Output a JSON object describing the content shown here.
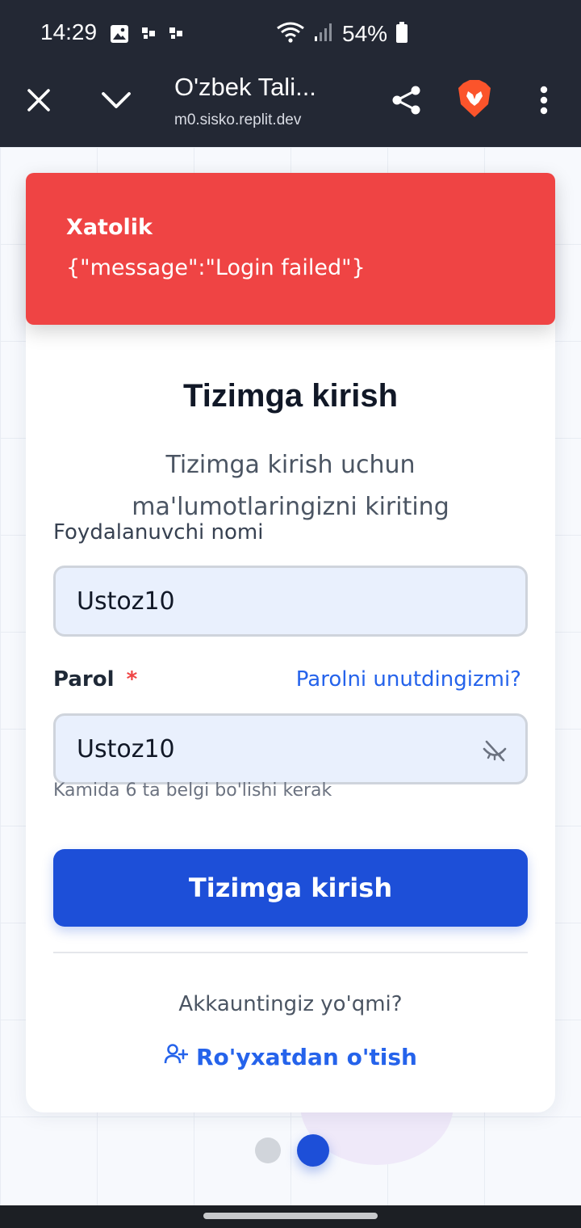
{
  "status_bar": {
    "time": "14:29",
    "battery": "54%"
  },
  "browser": {
    "title": "O'zbek Tali...",
    "url": "m0.sisko.replit.dev",
    "brand_color": "#fb542b"
  },
  "toast": {
    "title": "Xatolik",
    "message": "{\"message\":\"Login failed\"}",
    "color": "#ef4444"
  },
  "login": {
    "title": "Tizimga kirish",
    "subtitle": "Tizimga kirish uchun ma'lumotlaringizni kiriting",
    "username_label": "Foydalanuvchi nomi",
    "username_value": "Ustoz10",
    "password_label": "Parol",
    "required_mark": "*",
    "forgot_link": "Parolni unutdingizmi?",
    "password_value": "Ustoz10",
    "password_hint": "Kamida 6 ta belgi bo'lishi kerak",
    "submit_label": "Tizimga kirish",
    "no_account_text": "Akkauntingiz yo'qmi?",
    "register_link": "Ro'yxatdan o'tish",
    "accent_color": "#1d4fd8"
  },
  "icons": {
    "status": [
      "image-icon",
      "notification-icon",
      "notification-icon",
      "wifi-icon",
      "signal-icon",
      "battery-icon"
    ],
    "toolbar": [
      "close-icon",
      "chevron-down-icon",
      "share-icon",
      "brave-lion-icon",
      "more-vert-icon"
    ],
    "form": [
      "eye-off-icon",
      "user-plus-icon"
    ]
  }
}
